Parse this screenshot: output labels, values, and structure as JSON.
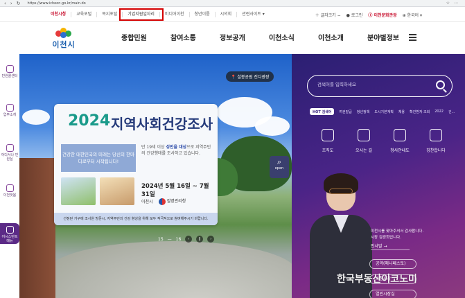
{
  "browser": {
    "url": "https://www.icheon.go.kr/main.do"
  },
  "topbar": {
    "links": [
      "이천시청",
      "교육포털",
      "복지포털",
      "기업지원일자리",
      "미디어이천",
      "청년이룸",
      "시의회",
      "관련사이트 ▾"
    ],
    "highlighted": "기업지원일자리",
    "font": "글자크기",
    "login": "로그인",
    "culture": "이천문화관광",
    "lang": "한국어"
  },
  "header": {
    "logo": "이천시",
    "gnb": [
      "종합민원",
      "참여소통",
      "정보공개",
      "이천소식",
      "이천소개",
      "분야별정보"
    ]
  },
  "quick": [
    "민원콜센터",
    "업무소개",
    "어디서나 민원실",
    "이천맛봄",
    "어시스턴트 메뉴"
  ],
  "hero": {
    "location": "설봉공원 진디광장",
    "notice": {
      "year": "2024",
      "title": "지역사회건강조사",
      "box": "건강한 대한민국의 미래는 당신의 한마디로부터 시작됩니다!",
      "desc1": "만 19세 이상 ",
      "desc_b": "성인을 대상",
      "desc2": "으로 지역주민의 건강행태를 조사하고 있습니다.",
      "date": "2024년 5월 16일 ~ 7월 31일",
      "org1": "이천시",
      "org2": "질병관리청",
      "footer": "선정된 가구에 조사원 방문시, 지역주민의 건강 향상을 위해 모두 적극적으로 참여해주시기 바랍니다."
    },
    "slide_current": "15",
    "slide_total": "16",
    "open_label": "open"
  },
  "panel": {
    "search_placeholder": "검색어를 입력하세요",
    "hot_label": "HOT 검색어",
    "hot": [
      "여권발급",
      "청년정책",
      "도시기본계획",
      "채용",
      "확진환자 조회",
      "2022",
      "건..."
    ],
    "services": [
      "조직도",
      "오시는 길",
      "청사안내도",
      "칭찬합니다"
    ],
    "mayor_greeting": "이천시를 찾아주셔서 감사합니다.",
    "mayor_name": "시장 김경희입니다.",
    "mayor_btn": "인사말 →",
    "mayor_links": [
      "공약(매니페스토)",
      "소통광장",
      "열린시장실"
    ]
  },
  "watermark": "한국부동산이코노미",
  "colors": {
    "accent_red": "#c8102e",
    "panel_purple": "#4a2487",
    "teal": "#1a9a8a",
    "navy": "#253a7a"
  }
}
